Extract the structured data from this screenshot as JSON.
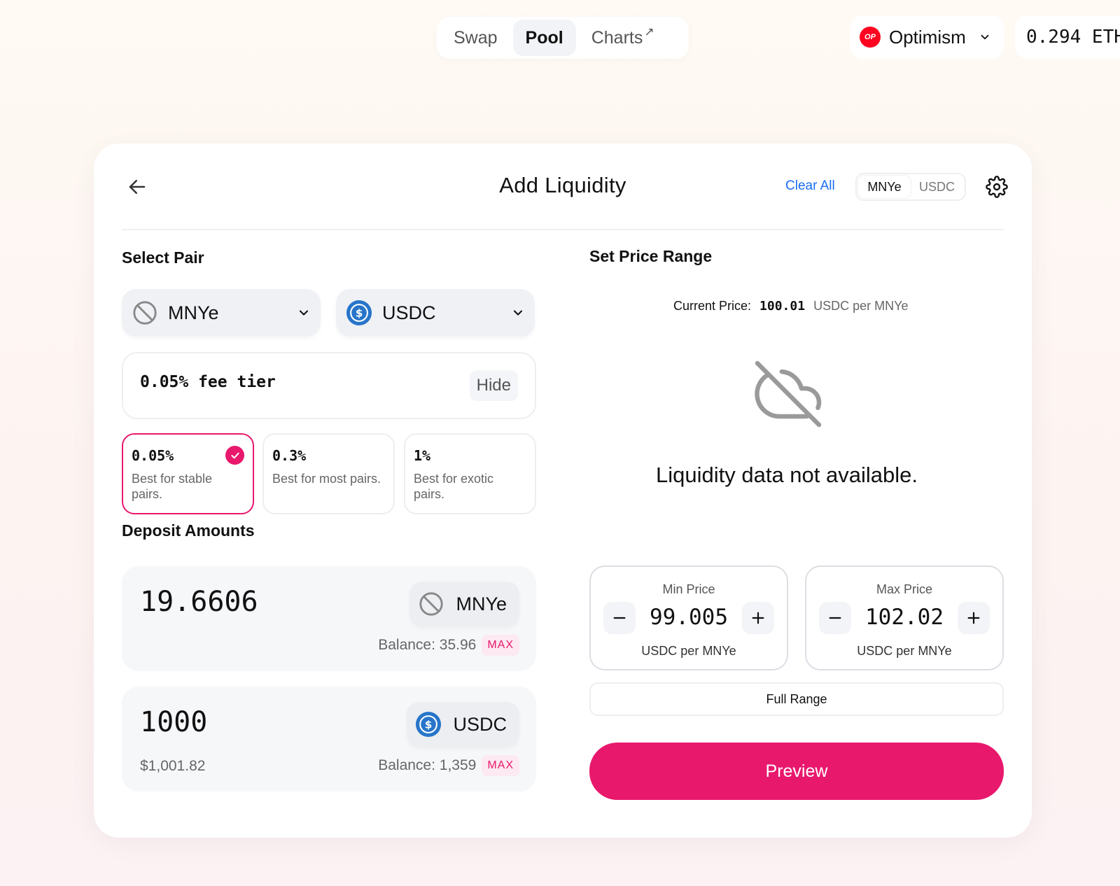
{
  "nav": {
    "tabs": [
      {
        "label": "Swap"
      },
      {
        "label": "Pool"
      },
      {
        "label": "Charts",
        "external_glyph": "↗"
      }
    ],
    "network": {
      "label": "Optimism",
      "logo_text": "OP",
      "logo_color": "#ff0420"
    },
    "balance": "0.294 ETH"
  },
  "card": {
    "title": "Add Liquidity",
    "clear_all": "Clear All",
    "token_toggle": [
      "MNYe",
      "USDC"
    ],
    "accent_color": "#e8186d",
    "link_color": "#1a6df2"
  },
  "select_pair": {
    "label": "Select Pair",
    "token_a": "MNYe",
    "token_b": "USDC"
  },
  "fee_tier": {
    "label": "0.05% fee tier",
    "hide_label": "Hide",
    "options": [
      {
        "pct": "0.05%",
        "desc": "Best for stable pairs.",
        "selected": true
      },
      {
        "pct": "0.3%",
        "desc": "Best for most pairs.",
        "selected": false
      },
      {
        "pct": "1%",
        "desc": "Best for exotic pairs.",
        "selected": false
      }
    ]
  },
  "deposit": {
    "label": "Deposit Amounts",
    "items": [
      {
        "amount": "19.6606",
        "token": "MNYe",
        "balance": "Balance: 35.96",
        "max": "MAX",
        "usd": ""
      },
      {
        "amount": "1000",
        "token": "USDC",
        "balance": "Balance: 1,359",
        "max": "MAX",
        "usd": "$1,001.82"
      }
    ]
  },
  "price_range": {
    "label": "Set Price Range",
    "current_label": "Current Price:",
    "current_value": "100.01",
    "current_unit": "USDC per MNYe",
    "no_data": "Liquidity data not available.",
    "min": {
      "label": "Min Price",
      "value": "99.005",
      "unit": "USDC per MNYe"
    },
    "max": {
      "label": "Max Price",
      "value": "102.02",
      "unit": "USDC per MNYe"
    },
    "full_range": "Full Range",
    "preview": "Preview"
  }
}
